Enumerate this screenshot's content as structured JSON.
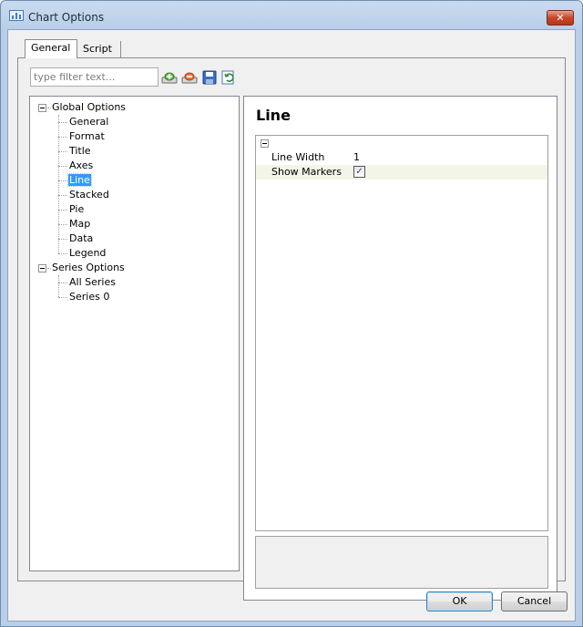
{
  "window": {
    "title": "Chart Options",
    "close_symbol": "✕"
  },
  "tabs": [
    {
      "label": "General",
      "active": true
    },
    {
      "label": "Script",
      "active": false
    }
  ],
  "filter": {
    "placeholder": "type filter text..."
  },
  "toolbar_icons": [
    "add-icon",
    "remove-icon",
    "save-icon",
    "refresh-icon"
  ],
  "tree": {
    "global": {
      "label": "Global Options",
      "children": [
        "General",
        "Format",
        "Title",
        "Axes",
        "Line",
        "Stacked",
        "Pie",
        "Map",
        "Data",
        "Legend"
      ]
    },
    "series": {
      "label": "Series Options",
      "children": [
        "All Series",
        "Series 0"
      ]
    },
    "selected": "Line"
  },
  "detail": {
    "title": "Line",
    "properties": [
      {
        "name": "Line Width",
        "value": "1"
      },
      {
        "name": "Show Markers",
        "checked": true,
        "check_glyph": "✓"
      }
    ]
  },
  "buttons": {
    "ok": "OK",
    "cancel": "Cancel"
  },
  "colors": {
    "selection": "#3399ff",
    "title_bar": "#b9cfe9",
    "close": "#c8462a"
  }
}
